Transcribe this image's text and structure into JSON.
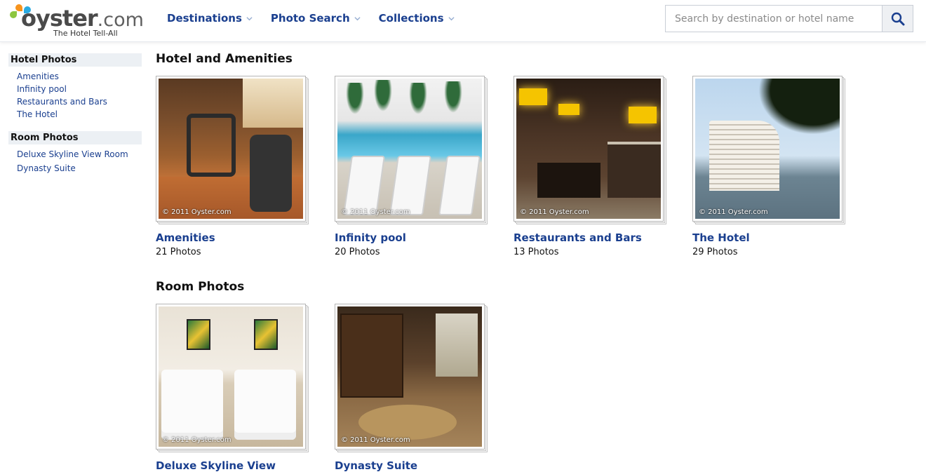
{
  "brand": {
    "name": "oyster",
    "suffix": ".com",
    "tagline": "The Hotel Tell-All"
  },
  "nav": {
    "items": [
      {
        "label": "Destinations"
      },
      {
        "label": "Photo Search"
      },
      {
        "label": "Collections"
      }
    ]
  },
  "search": {
    "placeholder": "Search by destination or hotel name",
    "value": ""
  },
  "sidebar": {
    "groups": [
      {
        "heading": "Hotel Photos",
        "items": [
          "Amenities",
          "Infinity pool",
          "Restaurants and Bars",
          "The Hotel"
        ]
      },
      {
        "heading": "Room Photos",
        "items": [
          "Deluxe Skyline View Room",
          "Dynasty Suite"
        ]
      }
    ]
  },
  "sections": [
    {
      "title": "Hotel and Amenities",
      "cards": [
        {
          "title": "Amenities",
          "count": "21 Photos",
          "copyright": "© 2011 Oyster.com"
        },
        {
          "title": "Infinity pool",
          "count": "20 Photos",
          "copyright": "© 2011 Oyster.com"
        },
        {
          "title": "Restaurants and Bars",
          "count": "13 Photos",
          "copyright": "© 2011 Oyster.com"
        },
        {
          "title": "The Hotel",
          "count": "29 Photos",
          "copyright": "© 2011 Oyster.com"
        }
      ]
    },
    {
      "title": "Room Photos",
      "cards": [
        {
          "title": "Deluxe Skyline View",
          "copyright": "© 2011 Oyster.com"
        },
        {
          "title": "Dynasty Suite",
          "copyright": "© 2011 Oyster.com"
        }
      ]
    }
  ],
  "colors": {
    "link": "#1a3f8f",
    "sidebar_heading_bg": "#ecf0f4"
  }
}
